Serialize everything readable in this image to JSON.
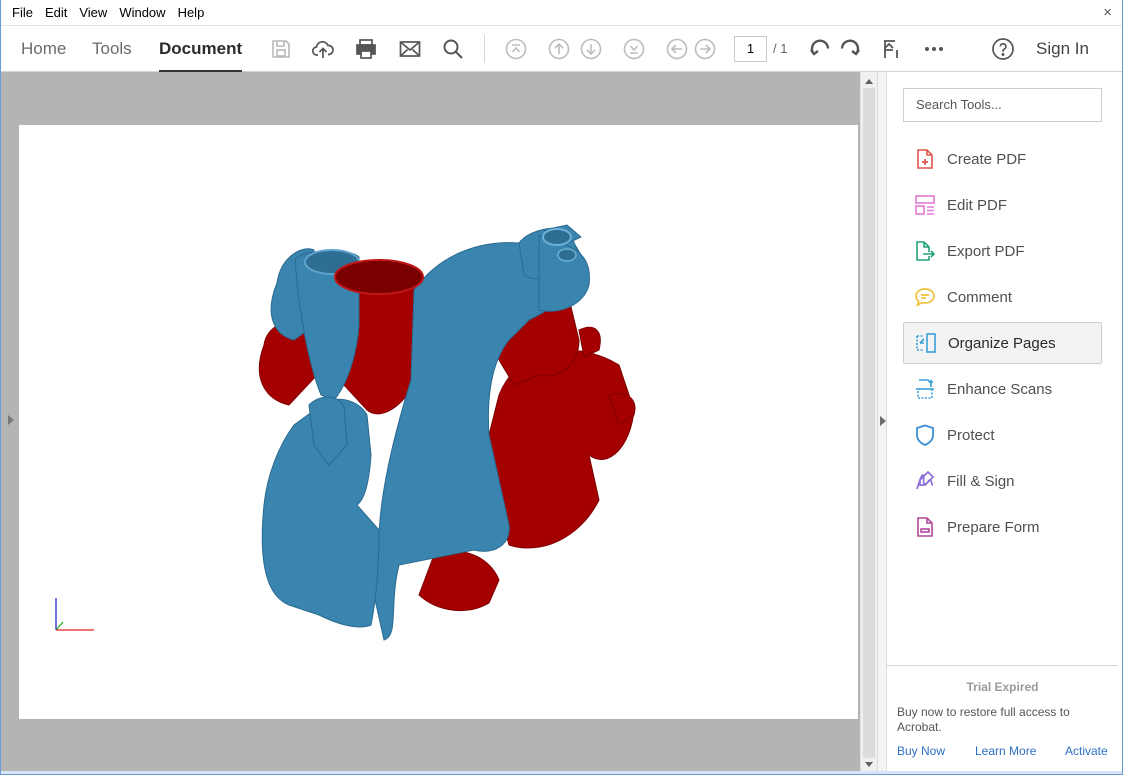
{
  "menu": {
    "items": [
      "File",
      "Edit",
      "View",
      "Window",
      "Help"
    ],
    "close_glyph": "×"
  },
  "toolbar": {
    "tabs": [
      {
        "label": "Home",
        "active": false
      },
      {
        "label": "Tools",
        "active": false
      },
      {
        "label": "Document",
        "active": true
      }
    ],
    "icons": [
      "save-icon",
      "upload-cloud-icon",
      "print-icon",
      "email-icon",
      "search-icon",
      "first-page-icon",
      "previous-page-icon",
      "next-page-icon",
      "last-page-icon",
      "back-icon",
      "forward-icon",
      "rotate-counterclockwise-icon",
      "rotate-clockwise-icon",
      "read-mode-icon",
      "more-icon",
      "help-icon"
    ],
    "page_current": "1",
    "page_total": "/ 1",
    "signin_label": "Sign In"
  },
  "document": {
    "model_colors": {
      "vessel_blue": "#3a84b0",
      "vessel_red": "#a40000"
    },
    "axis_colors": [
      "#2a2ad0",
      "#20b020",
      "#e02020"
    ]
  },
  "right_pane": {
    "search_placeholder": "Search Tools...",
    "tools": [
      {
        "label": "Create PDF",
        "icon": "create-pdf-icon",
        "color": "#e0554e",
        "selected": false
      },
      {
        "label": "Edit PDF",
        "icon": "edit-pdf-icon",
        "color": "#e37bd6",
        "selected": false
      },
      {
        "label": "Export PDF",
        "icon": "export-pdf-icon",
        "color": "#23a37b",
        "selected": false
      },
      {
        "label": "Comment",
        "icon": "comment-icon",
        "color": "#f0c23a",
        "selected": false
      },
      {
        "label": "Organize Pages",
        "icon": "organize-pages-icon",
        "color": "#3aa0d8",
        "selected": true
      },
      {
        "label": "Enhance Scans",
        "icon": "enhance-scans-icon",
        "color": "#3aa0d8",
        "selected": false
      },
      {
        "label": "Protect",
        "icon": "protect-icon",
        "color": "#3b8ed6",
        "selected": false
      },
      {
        "label": "Fill & Sign",
        "icon": "fill-sign-icon",
        "color": "#8c6fd8",
        "selected": false
      },
      {
        "label": "Prepare Form",
        "icon": "prepare-form-icon",
        "color": "#b2479c",
        "selected": false
      }
    ],
    "trial": {
      "title": "Trial Expired",
      "message": "Buy now to restore full access to Acrobat.",
      "links": [
        "Buy Now",
        "Learn More",
        "Activate"
      ]
    }
  }
}
